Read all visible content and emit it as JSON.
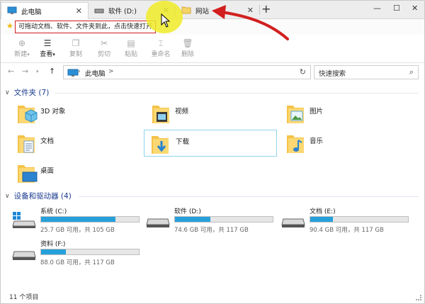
{
  "tabs": [
    {
      "label": "此电脑",
      "close": "✕"
    },
    {
      "label": "软件 (D:)",
      "close": "✕"
    },
    {
      "label": "网站",
      "close": "✕"
    }
  ],
  "newtab": "+",
  "window_controls": {
    "minimize": "—",
    "maximize": "☐",
    "close": "✕"
  },
  "quick_hint": "可拖动文档、软件、文件夹到此，点击快速打开",
  "ribbon": [
    {
      "label": "新建",
      "enabled": false
    },
    {
      "label": "查看",
      "enabled": true
    },
    {
      "label": "复制",
      "enabled": false
    },
    {
      "label": "剪切",
      "enabled": false
    },
    {
      "label": "粘贴",
      "enabled": false
    },
    {
      "label": "重命名",
      "enabled": false
    },
    {
      "label": "删除",
      "enabled": false
    }
  ],
  "address": {
    "path": "此电脑",
    "sep": ">"
  },
  "search": {
    "placeholder": "快速搜索"
  },
  "folders_section": {
    "title": "文件夹 (7)"
  },
  "folders": [
    {
      "label": "3D 对象"
    },
    {
      "label": "视频"
    },
    {
      "label": "图片"
    },
    {
      "label": "文档"
    },
    {
      "label": "下载"
    },
    {
      "label": "音乐"
    },
    {
      "label": "桌面"
    }
  ],
  "drives_section": {
    "title": "设备和驱动器 (4)"
  },
  "drives": [
    {
      "name": "系统 (C:)",
      "info": "25.7 GB 可用，共 105 GB",
      "used_fraction": 0.76
    },
    {
      "name": "软件 (D:)",
      "info": "74.6 GB 可用，共 117 GB",
      "used_fraction": 0.36
    },
    {
      "name": "文档 (E:)",
      "info": "90.4 GB 可用，共 117 GB",
      "used_fraction": 0.23
    },
    {
      "name": "资料 (F:)",
      "info": "88.0 GB 可用，共 117 GB",
      "used_fraction": 0.25
    }
  ],
  "status": "11 个项目",
  "colors": {
    "accent": "#26a0da",
    "section": "#1b3b8f",
    "annotation": "#d21f1f",
    "highlight": "#f0eb28"
  }
}
